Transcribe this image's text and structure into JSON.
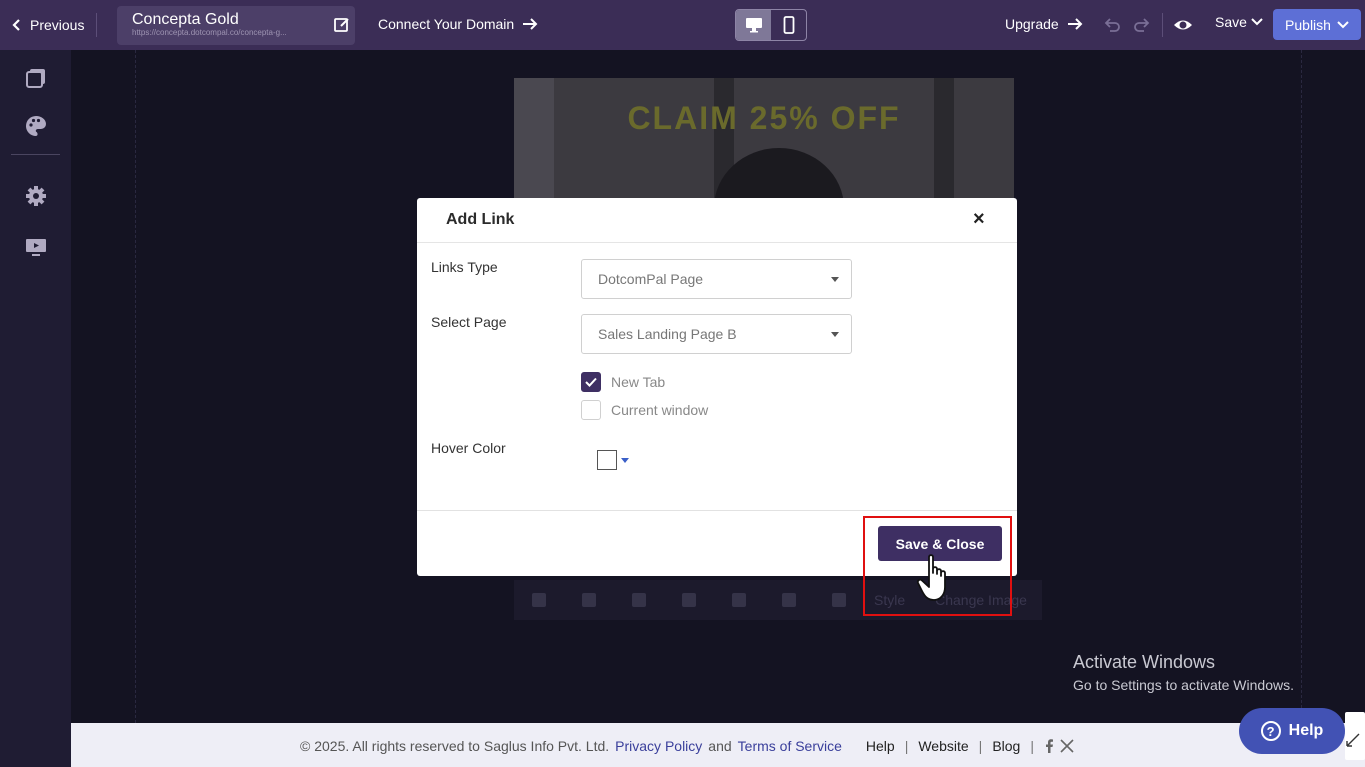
{
  "topbar": {
    "previous_label": "Previous",
    "site_name": "Concepta Gold",
    "site_url": "https://concepta.dotcompal.co/concepta-g...",
    "connect_label": "Connect Your Domain",
    "upgrade_label": "Upgrade",
    "save_label": "Save",
    "publish_label": "Publish"
  },
  "canvas": {
    "hero_text": "CLAIM 25% OFF",
    "toolbar_style": "Style",
    "toolbar_change_image": "Change Image"
  },
  "modal": {
    "title": "Add Link",
    "close_symbol": "×",
    "links_type_label": "Links Type",
    "links_type_value": "DotcomPal Page",
    "select_page_label": "Select Page",
    "select_page_value": "Sales Landing Page B",
    "new_tab_label": "New Tab",
    "new_tab_checked": true,
    "current_window_label": "Current window",
    "current_window_checked": false,
    "hover_color_label": "Hover Color",
    "save_close_label": "Save & Close"
  },
  "activate": {
    "title": "Activate Windows",
    "subtitle": "Go to Settings to activate Windows."
  },
  "footer": {
    "copyright": "©  2025. All rights reserved to Saglus Info Pvt. Ltd.",
    "privacy": "Privacy Policy",
    "and": "and",
    "terms": "Terms of Service",
    "help": "Help",
    "website": "Website",
    "blog": "Blog",
    "sep": "|"
  },
  "help_widget": {
    "label": "Help"
  },
  "colors": {
    "topbar": "#3b2d56",
    "accent": "#3e2f63",
    "publish": "#5d6fd6",
    "highlight": "#e01010"
  }
}
